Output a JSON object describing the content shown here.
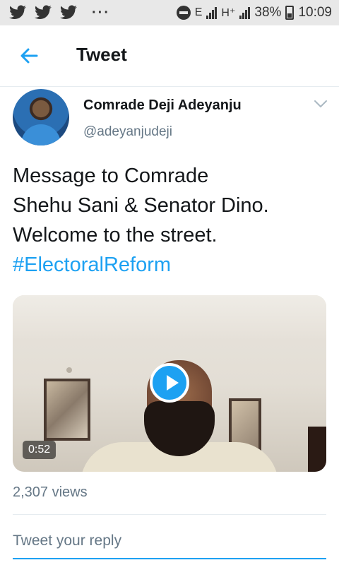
{
  "status_bar": {
    "network_e": "E",
    "network_h": "H⁺",
    "battery": "38%",
    "time": "10:09",
    "dots": "···"
  },
  "header": {
    "title": "Tweet"
  },
  "tweet": {
    "author_name": "Comrade Deji Adeyanju",
    "author_handle": "@adeyanjudeji",
    "text_lines": [
      "Message to Comrade",
      "Shehu Sani & Senator Dino.",
      "Welcome to the street."
    ],
    "hashtag": "#ElectoralReform",
    "video": {
      "duration": "0:52"
    },
    "views": "2,307 views"
  },
  "reply": {
    "placeholder": "Tweet your reply"
  },
  "colors": {
    "accent": "#1da1f2",
    "secondary_text": "#657786"
  }
}
